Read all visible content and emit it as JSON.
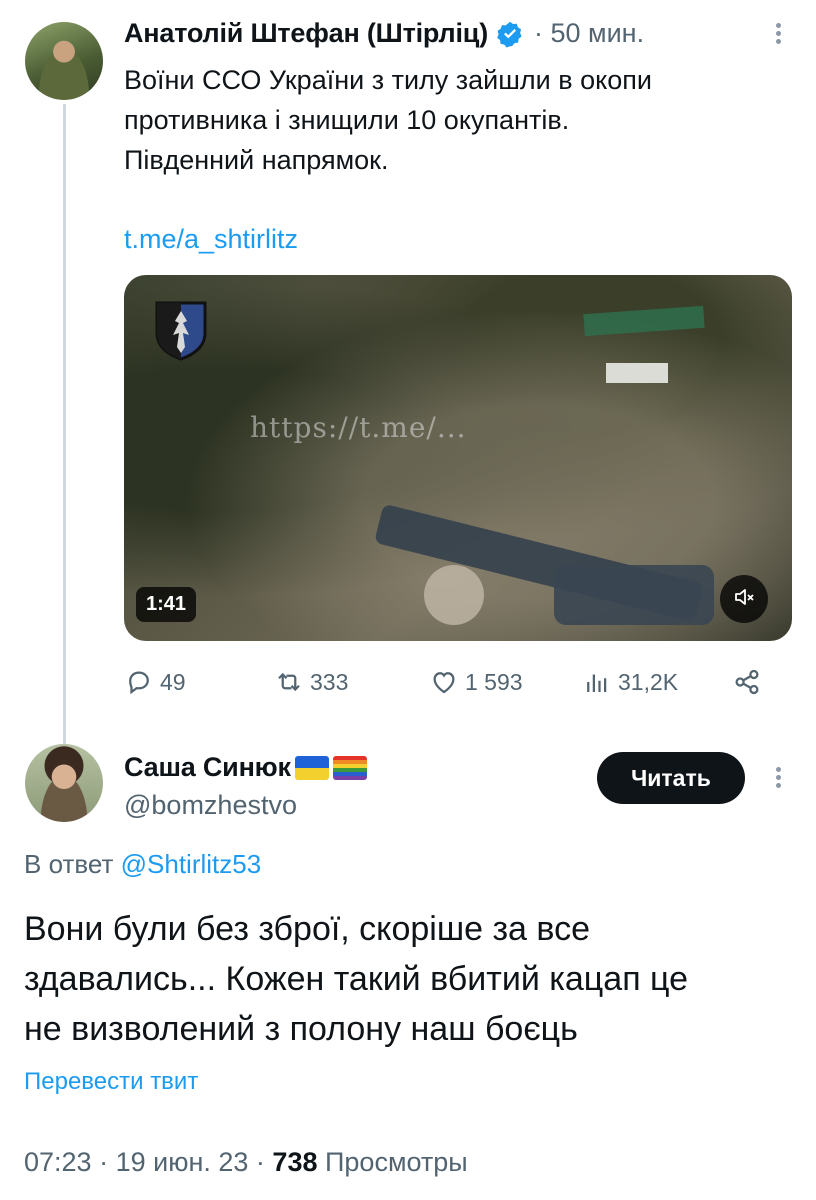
{
  "tweet1": {
    "display_name": "Анатолій Штефан (Штірліц)",
    "time": "· 50 мин.",
    "text_lines": [
      "Воїни ССО України з тилу зайшли в окопи",
      "противника і знищили 10 окупантів.",
      "Південний напрямок."
    ],
    "link": "t.me/a_shtirlitz",
    "video": {
      "duration": "1:41",
      "watermark": "https://t.me/..."
    },
    "actions": {
      "replies": "49",
      "retweets": "333",
      "likes": "1 593",
      "views": "31,2K"
    }
  },
  "tweet2": {
    "display_name": "Саша Синюк",
    "handle": "@bomzhestvo",
    "follow_label": "Читать",
    "reply_prefix": "В ответ",
    "reply_mention": "@Shtirlitz53",
    "text_lines": [
      "Вони були без зброї, скоріше за все",
      "здавались... Кожен такий вбитий кацап це",
      "не визволений з полону наш боєць"
    ],
    "translate_label": "Перевести твит",
    "meta": {
      "time": "07:23",
      "date": "19 июн. 23",
      "views_count": "738",
      "views_label": "Просмотры"
    }
  },
  "colors": {
    "accent": "#1d9bf0",
    "secondary_text": "#536471",
    "primary_text": "#0f1419"
  }
}
